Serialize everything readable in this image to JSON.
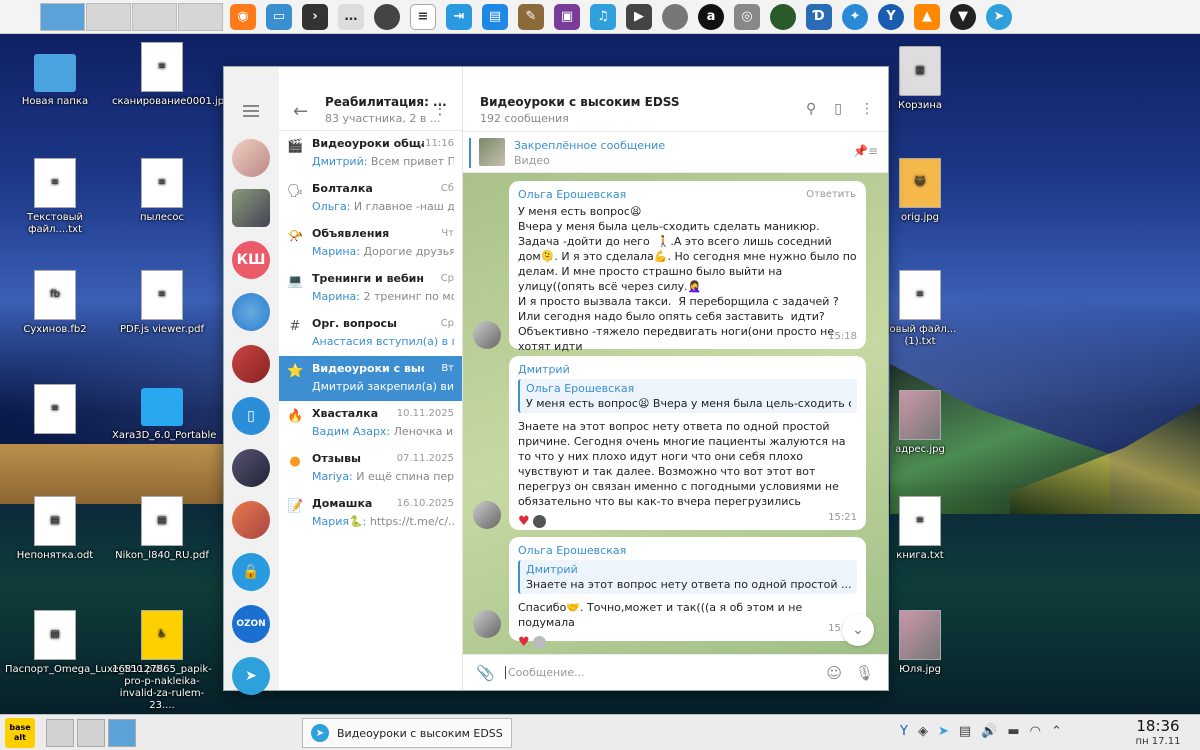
{
  "desktop": {
    "icons": [
      {
        "label": "Новая папка"
      },
      {
        "label": "сканирование0001.jpg"
      },
      {
        "label": "Текстовый файл....txt"
      },
      {
        "label": "пылесос"
      },
      {
        "label": "Сухинов.fb2"
      },
      {
        "label": "PDF.js viewer.pdf"
      },
      {
        "label": "Xara3D_6.0_Portable"
      },
      {
        "label": "Непонятка.odt"
      },
      {
        "label": "Nikon_l840_RU.pdf"
      },
      {
        "label": "Паспорт_Omega_Luxe_550.pdf"
      },
      {
        "label": "1681127865_papik-pro-p-nakleika-invalid-za-rulem-23...."
      },
      {
        "label": "Корзина"
      },
      {
        "label": "orig.jpg"
      },
      {
        "label": "товый файл... (1).txt"
      },
      {
        "label": "адрес.jpg"
      },
      {
        "label": "книга.txt"
      },
      {
        "label": "Юля.jpg"
      }
    ]
  },
  "folders_sidebar": {
    "badge_ksh": "КШ",
    "badge_ozon": "OZON"
  },
  "chatlist": {
    "title": "Реабилитация: ...",
    "subtitle": "83 участника, 2 в ...",
    "items": [
      {
        "name": "Видеоуроки обща...",
        "time": "11:16",
        "author": "Дмитрий:",
        "msg": " Всем привет  Пре..."
      },
      {
        "name": "Болталка",
        "time": "Сб",
        "author": "Ольга:",
        "msg": " И главное -наш д..."
      },
      {
        "name": "Объявления",
        "time": "Чт",
        "author": "Марина:",
        "msg": " Дорогие друзья..."
      },
      {
        "name": "Тренинги и вебинары",
        "time": "Ср",
        "author": "Марина:",
        "msg": " 2 тренинг по мо..."
      },
      {
        "name": "Орг. вопросы",
        "time": "Ср",
        "author": "Анастасия вступил(а) в г...",
        "msg": ""
      },
      {
        "name": "Видеоуроки с высок...",
        "time": "Вт",
        "author": "Дмитрий закрепил(а) ви...",
        "msg": ""
      },
      {
        "name": "Хвасталка",
        "time": "10.11.2025",
        "author": "Вадим Азарх:",
        "msg": " Леночка и ..."
      },
      {
        "name": "Отзывы",
        "time": "07.11.2025",
        "author": "Mariya:",
        "msg": " И ещё спина пер..."
      },
      {
        "name": "Домашка",
        "time": "16.10.2025",
        "author": "Мария🐍:",
        "msg": " https://t.me/c/..."
      }
    ]
  },
  "conversation": {
    "title": "Видеоуроки с высоким EDSS",
    "subtitle": "192 сообщения",
    "pinned_title": "Закреплённое сообщение",
    "pinned_sub": "Видео",
    "messages": [
      {
        "author": "Ольга Ерошевская",
        "reply_label": "Ответить",
        "text": "У меня есть вопрос😫\nВчера у меня была цель-сходить сделать маникюр. Задача -дойти до него  🚶.А это всего лишь соседний дом🫠. И я это сделала💪. Но сегодня мне нужно было по делам. И мне просто страшно было выйти на улицу((опять всё через силу.🤦‍♀️\nИ я просто вызвала такси.  Я переборщила с задачей ? Или сегодня надо было опять себя заставить  идти?Объективно -тяжело передвигать ноги(они просто не хотят идти",
        "time": "15:18"
      },
      {
        "author": "Дмитрий",
        "quote_author": "Ольга Ерошевская",
        "quote_text": "У меня есть вопрос😫 Вчера у меня была цель-сходить сде...",
        "text": "Знаете на этот вопрос нету ответа по одной простой причине. Сегодня очень многие пациенты жалуются на то что у них плохо идут ноги что они себя плохо чувствуют и так далее. Возможно что вот этот вот перегруз он связан именно с погодными условиями не обязательно что вы как-то вчера перегрузились",
        "time": "15:21"
      },
      {
        "author": "Ольга Ерошевская",
        "quote_author": "Дмитрий",
        "quote_text": "Знаете на этот вопрос нету ответа по одной простой ...",
        "text": "Спасибо🤝. Точно,может и так(((а я об этом и не подумала",
        "time": "15:24"
      }
    ],
    "composer_placeholder": "Сообщение..."
  },
  "taskbar": {
    "start_label": "base alt",
    "window_label": "Видеоуроки с высоким EDSS",
    "time": "18:36",
    "date": "пн 17.11"
  }
}
